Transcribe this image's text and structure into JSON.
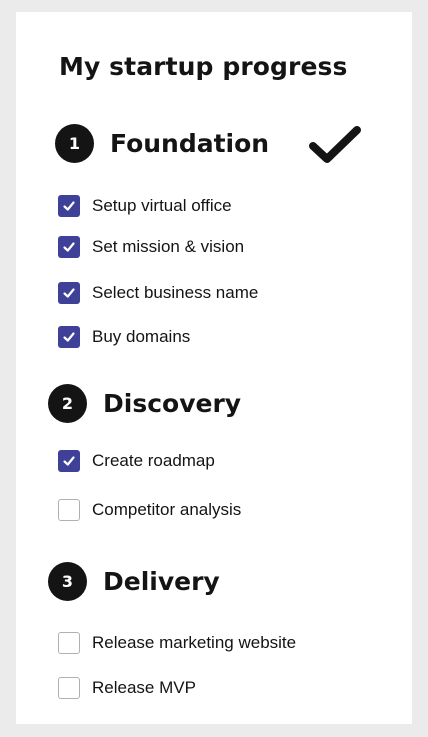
{
  "page": {
    "title": "My startup progress"
  },
  "sections": [
    {
      "number": "1",
      "title": "Foundation",
      "completed": true,
      "tasks": [
        {
          "label": "Setup virtual office",
          "checked": true
        },
        {
          "label": "Set mission & vision",
          "checked": true
        },
        {
          "label": "Select business name",
          "checked": true
        },
        {
          "label": "Buy domains",
          "checked": true
        }
      ]
    },
    {
      "number": "2",
      "title": "Discovery",
      "completed": false,
      "tasks": [
        {
          "label": "Create roadmap",
          "checked": true
        },
        {
          "label": "Competitor analysis",
          "checked": false
        }
      ]
    },
    {
      "number": "3",
      "title": "Delivery",
      "completed": false,
      "tasks": [
        {
          "label": "Release marketing website",
          "checked": false
        },
        {
          "label": "Release MVP",
          "checked": false
        }
      ]
    }
  ],
  "colors": {
    "checkbox_checked": "#3e4197",
    "badge": "#141414",
    "background": "#ebebeb",
    "card": "#ffffff"
  },
  "icons": {
    "section_complete": "checkmark-icon",
    "checkbox_checked": "check-icon"
  }
}
